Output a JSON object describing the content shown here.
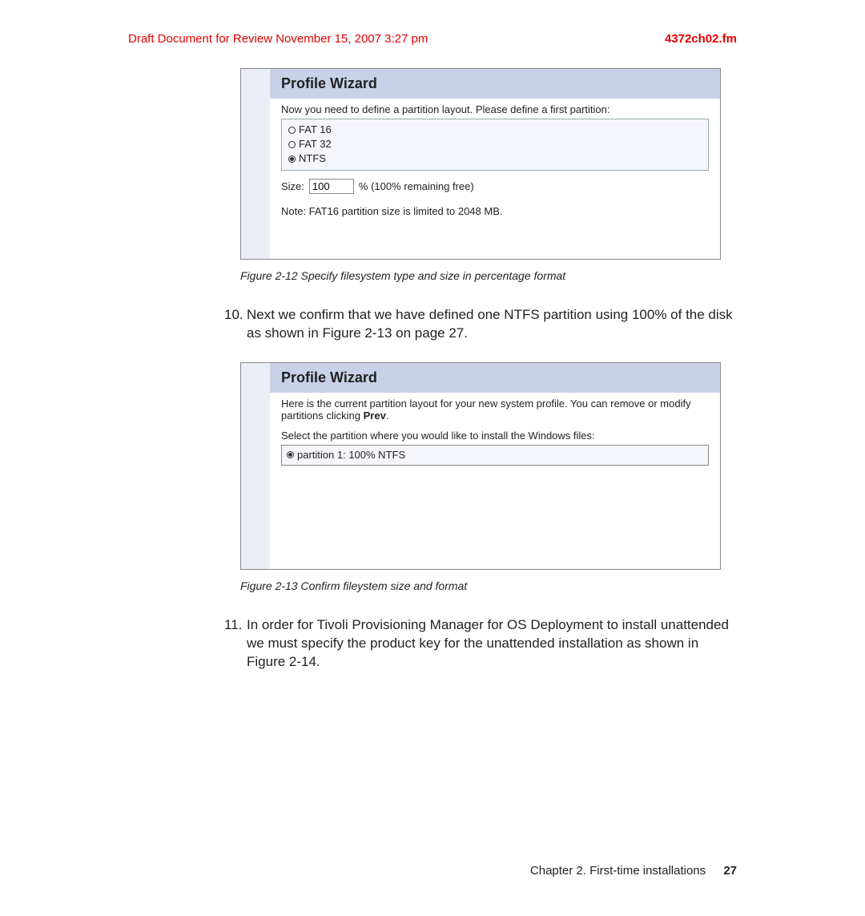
{
  "header": {
    "draft_text": "Draft Document for Review November 15, 2007 3:27 pm",
    "filename": "4372ch02.fm"
  },
  "wizard1": {
    "title": "Profile Wizard",
    "description": "Now you need to define a partition layout. Please define a first partition:",
    "options": {
      "fat16": "FAT 16",
      "fat32": "FAT 32",
      "ntfs": "NTFS"
    },
    "size_label": "Size:",
    "size_value": "100",
    "size_suffix": "% (100% remaining free)",
    "note": "Note: FAT16 partition size is limited to 2048 MB."
  },
  "caption1": "Figure 2-12   Specify filesystem type and size in percentage format",
  "step10": {
    "num": "10.",
    "text": "Next we confirm that we have defined one NTFS partition using 100% of the disk as shown in Figure 2-13 on page 27."
  },
  "wizard2": {
    "title": "Profile Wizard",
    "desc1a": "Here is the current partition layout for your new system profile. You can remove or modify partitions clicking ",
    "desc1b": "Prev",
    "desc1c": ".",
    "select_label": "Select the partition where you would like to install the Windows files:",
    "partition_option": "partition 1: 100% NTFS"
  },
  "caption2": "Figure 2-13   Confirm fileystem size and format",
  "step11": {
    "num": "11.",
    "text": "In order for Tivoli Provisioning Manager for OS Deployment to install unattended we must specify the product key for the unattended installation as shown in Figure 2-14."
  },
  "footer": {
    "chapter": "Chapter 2. First-time installations",
    "page": "27"
  }
}
